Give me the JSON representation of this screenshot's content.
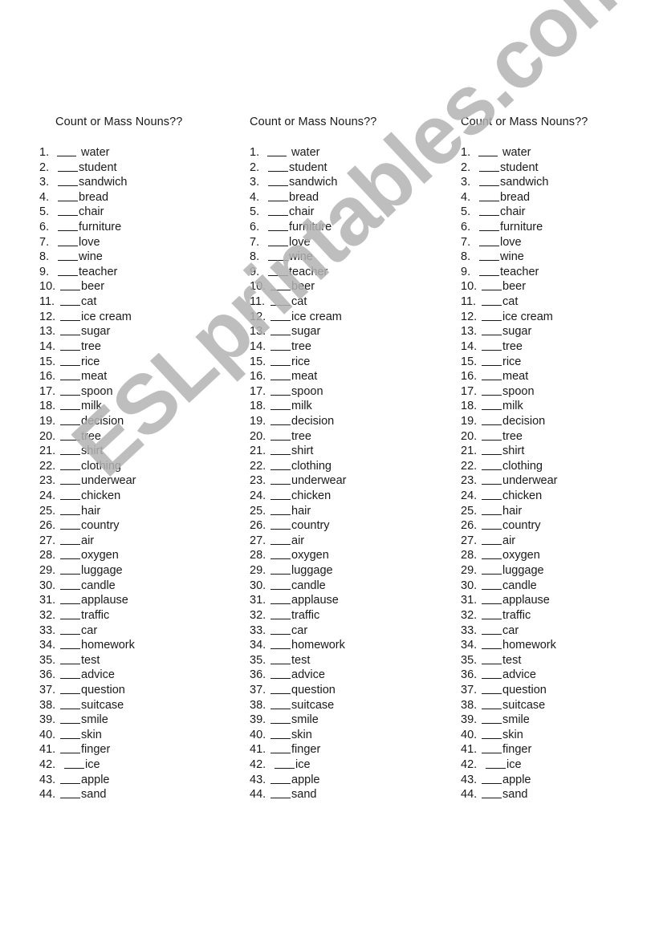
{
  "worksheet": {
    "watermark": "ESLprintables.com",
    "columns": [
      {
        "title": "Count or Mass Nouns??",
        "items": [
          {
            "number": "1.",
            "word": "water"
          },
          {
            "number": "2.",
            "word": "student"
          },
          {
            "number": "3.",
            "word": "sandwich"
          },
          {
            "number": "4.",
            "word": "bread"
          },
          {
            "number": "5.",
            "word": "chair"
          },
          {
            "number": "6.",
            "word": "furniture"
          },
          {
            "number": "7.",
            "word": "love"
          },
          {
            "number": "8.",
            "word": "wine"
          },
          {
            "number": "9.",
            "word": "teacher"
          },
          {
            "number": "10.",
            "word": "beer"
          },
          {
            "number": "11.",
            "word": "cat"
          },
          {
            "number": "12.",
            "word": "ice cream"
          },
          {
            "number": "13.",
            "word": "sugar"
          },
          {
            "number": "14.",
            "word": "tree"
          },
          {
            "number": "15.",
            "word": "rice"
          },
          {
            "number": "16.",
            "word": "meat"
          },
          {
            "number": "17.",
            "word": "spoon"
          },
          {
            "number": "18.",
            "word": "milk"
          },
          {
            "number": "19.",
            "word": "decision"
          },
          {
            "number": "20.",
            "word": "tree"
          },
          {
            "number": "21.",
            "word": "shirt"
          },
          {
            "number": "22.",
            "word": "clothing"
          },
          {
            "number": "23.",
            "word": "underwear"
          },
          {
            "number": "24.",
            "word": "chicken"
          },
          {
            "number": "25.",
            "word": "hair"
          },
          {
            "number": "26.",
            "word": "country"
          },
          {
            "number": "27.",
            "word": "air"
          },
          {
            "number": "28.",
            "word": "oxygen"
          },
          {
            "number": "29.",
            "word": "luggage"
          },
          {
            "number": "30.",
            "word": "candle"
          },
          {
            "number": "31.",
            "word": "applause"
          },
          {
            "number": "32.",
            "word": "traffic"
          },
          {
            "number": "33.",
            "word": "car"
          },
          {
            "number": "34.",
            "word": "homework"
          },
          {
            "number": "35.",
            "word": "test"
          },
          {
            "number": "36.",
            "word": "advice"
          },
          {
            "number": "37.",
            "word": "question"
          },
          {
            "number": "38.",
            "word": "suitcase"
          },
          {
            "number": "39.",
            "word": "smile"
          },
          {
            "number": "40.",
            "word": "skin"
          },
          {
            "number": "41.",
            "word": "finger"
          },
          {
            "number": "42.",
            "word": "ice"
          },
          {
            "number": "43.",
            "word": "apple"
          },
          {
            "number": "44.",
            "word": "sand"
          }
        ]
      },
      {
        "title": "Count or Mass Nouns??",
        "items": [
          {
            "number": "1.",
            "word": "water"
          },
          {
            "number": "2.",
            "word": "student"
          },
          {
            "number": "3.",
            "word": "sandwich"
          },
          {
            "number": "4.",
            "word": "bread"
          },
          {
            "number": "5.",
            "word": "chair"
          },
          {
            "number": "6.",
            "word": "furniture"
          },
          {
            "number": "7.",
            "word": "love"
          },
          {
            "number": "8.",
            "word": "wine"
          },
          {
            "number": "9.",
            "word": "teacher"
          },
          {
            "number": "10.",
            "word": "beer"
          },
          {
            "number": "11.",
            "word": "cat"
          },
          {
            "number": "12.",
            "word": "ice cream"
          },
          {
            "number": "13.",
            "word": "sugar"
          },
          {
            "number": "14.",
            "word": "tree"
          },
          {
            "number": "15.",
            "word": "rice"
          },
          {
            "number": "16.",
            "word": "meat"
          },
          {
            "number": "17.",
            "word": "spoon"
          },
          {
            "number": "18.",
            "word": "milk"
          },
          {
            "number": "19.",
            "word": "decision"
          },
          {
            "number": "20.",
            "word": "tree"
          },
          {
            "number": "21.",
            "word": "shirt"
          },
          {
            "number": "22.",
            "word": "clothing"
          },
          {
            "number": "23.",
            "word": "underwear"
          },
          {
            "number": "24.",
            "word": "chicken"
          },
          {
            "number": "25.",
            "word": "hair"
          },
          {
            "number": "26.",
            "word": "country"
          },
          {
            "number": "27.",
            "word": "air"
          },
          {
            "number": "28.",
            "word": "oxygen"
          },
          {
            "number": "29.",
            "word": "luggage"
          },
          {
            "number": "30.",
            "word": "candle"
          },
          {
            "number": "31.",
            "word": "applause"
          },
          {
            "number": "32.",
            "word": "traffic"
          },
          {
            "number": "33.",
            "word": "car"
          },
          {
            "number": "34.",
            "word": "homework"
          },
          {
            "number": "35.",
            "word": "test"
          },
          {
            "number": "36.",
            "word": "advice"
          },
          {
            "number": "37.",
            "word": "question"
          },
          {
            "number": "38.",
            "word": "suitcase"
          },
          {
            "number": "39.",
            "word": "smile"
          },
          {
            "number": "40.",
            "word": "skin"
          },
          {
            "number": "41.",
            "word": "finger"
          },
          {
            "number": "42.",
            "word": "ice"
          },
          {
            "number": "43.",
            "word": "apple"
          },
          {
            "number": "44.",
            "word": "sand"
          }
        ]
      },
      {
        "title": "Count or Mass Nouns??",
        "items": [
          {
            "number": "1.",
            "word": "water"
          },
          {
            "number": "2.",
            "word": "student"
          },
          {
            "number": "3.",
            "word": "sandwich"
          },
          {
            "number": "4.",
            "word": "bread"
          },
          {
            "number": "5.",
            "word": "chair"
          },
          {
            "number": "6.",
            "word": "furniture"
          },
          {
            "number": "7.",
            "word": "love"
          },
          {
            "number": "8.",
            "word": "wine"
          },
          {
            "number": "9.",
            "word": "teacher"
          },
          {
            "number": "10.",
            "word": "beer"
          },
          {
            "number": "11.",
            "word": "cat"
          },
          {
            "number": "12.",
            "word": "ice cream"
          },
          {
            "number": "13.",
            "word": "sugar"
          },
          {
            "number": "14.",
            "word": "tree"
          },
          {
            "number": "15.",
            "word": "rice"
          },
          {
            "number": "16.",
            "word": "meat"
          },
          {
            "number": "17.",
            "word": "spoon"
          },
          {
            "number": "18.",
            "word": "milk"
          },
          {
            "number": "19.",
            "word": "decision"
          },
          {
            "number": "20.",
            "word": "tree"
          },
          {
            "number": "21.",
            "word": "shirt"
          },
          {
            "number": "22.",
            "word": "clothing"
          },
          {
            "number": "23.",
            "word": "underwear"
          },
          {
            "number": "24.",
            "word": "chicken"
          },
          {
            "number": "25.",
            "word": "hair"
          },
          {
            "number": "26.",
            "word": "country"
          },
          {
            "number": "27.",
            "word": "air"
          },
          {
            "number": "28.",
            "word": "oxygen"
          },
          {
            "number": "29.",
            "word": "luggage"
          },
          {
            "number": "30.",
            "word": "candle"
          },
          {
            "number": "31.",
            "word": "applause"
          },
          {
            "number": "32.",
            "word": "traffic"
          },
          {
            "number": "33.",
            "word": "car"
          },
          {
            "number": "34.",
            "word": "homework"
          },
          {
            "number": "35.",
            "word": "test"
          },
          {
            "number": "36.",
            "word": "advice"
          },
          {
            "number": "37.",
            "word": "question"
          },
          {
            "number": "38.",
            "word": "suitcase"
          },
          {
            "number": "39.",
            "word": "smile"
          },
          {
            "number": "40.",
            "word": "skin"
          },
          {
            "number": "41.",
            "word": "finger"
          },
          {
            "number": "42.",
            "word": "ice"
          },
          {
            "number": "43.",
            "word": "apple"
          },
          {
            "number": "44.",
            "word": "sand"
          }
        ]
      }
    ]
  }
}
